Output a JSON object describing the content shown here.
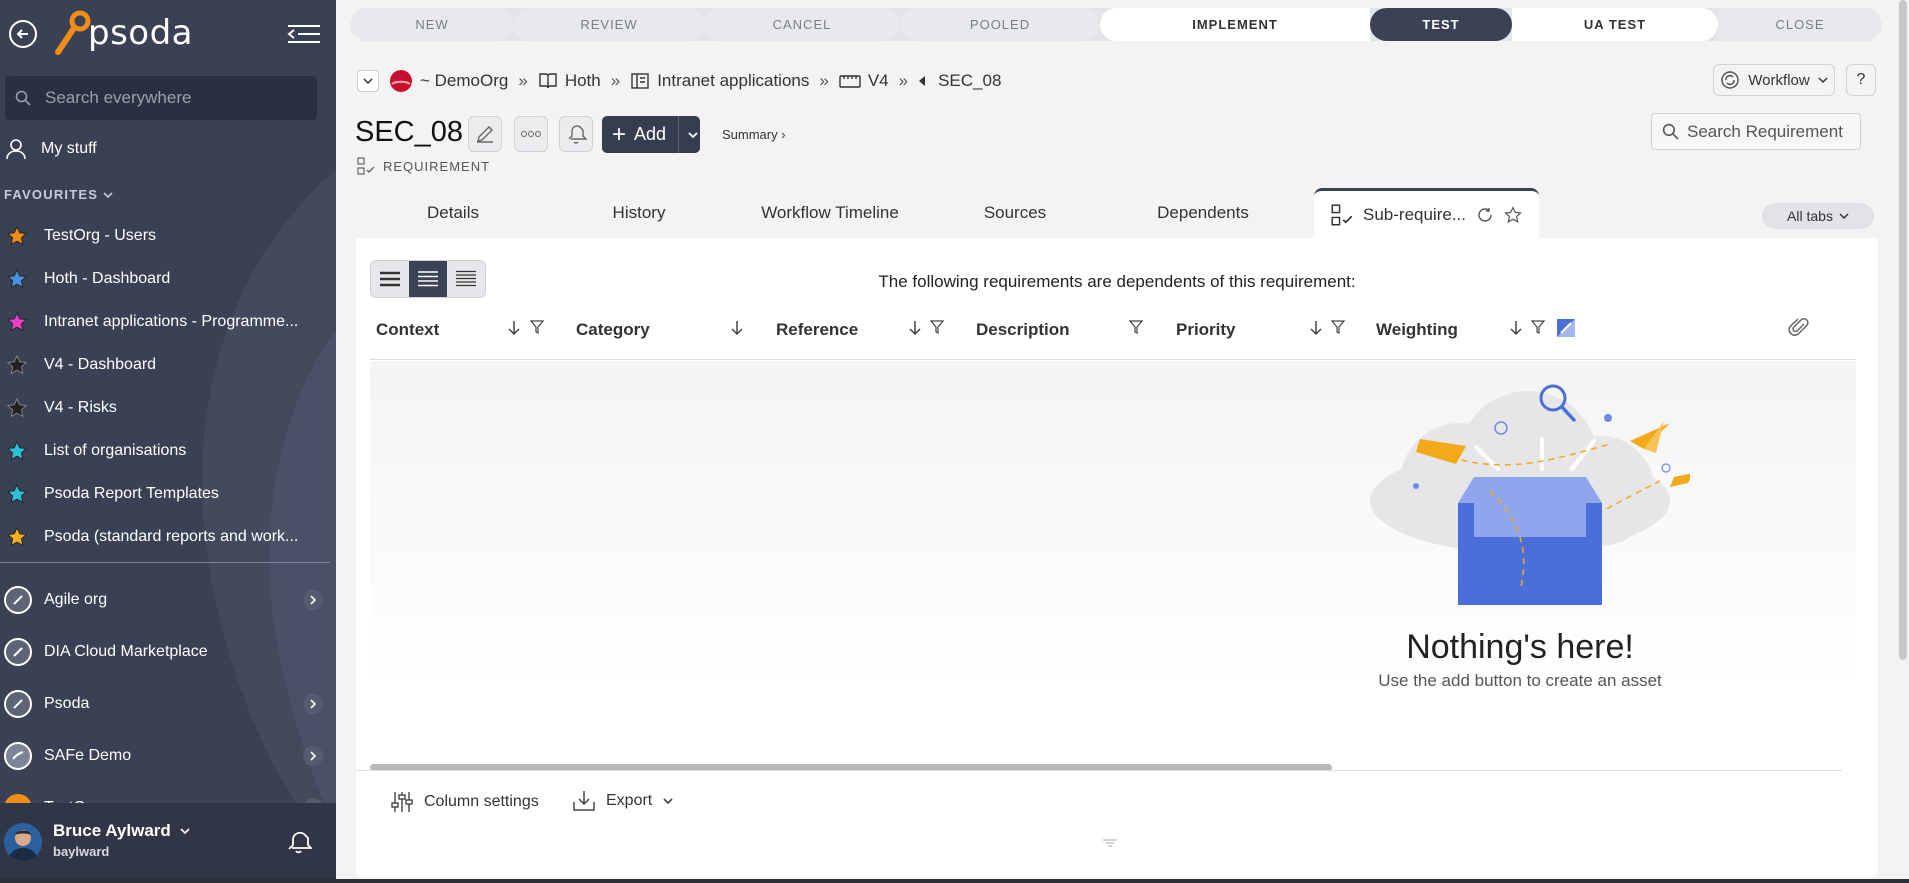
{
  "app": {
    "logo_text": "psoda",
    "accent_orange": "#f28c1a",
    "sidebar_bg": "#3a4154",
    "dark_navy": "#3b4256"
  },
  "sidebar": {
    "search_placeholder": "Search everywhere",
    "my_stuff": "My stuff",
    "favourites_label": "FAVOURITES",
    "favourites": [
      {
        "label": "TestOrg - Users",
        "star_color": "#f28c1a"
      },
      {
        "label": "Hoth - Dashboard",
        "star_color": "#4a90e2"
      },
      {
        "label": "Intranet applications - Programme...",
        "star_color": "#e83ec8"
      },
      {
        "label": "V4 - Dashboard",
        "star_color": "#222222"
      },
      {
        "label": "V4 - Risks",
        "star_color": "#222222"
      },
      {
        "label": "List of organisations",
        "star_color": "#2ec0d8"
      },
      {
        "label": "Psoda Report Templates",
        "star_color": "#2ec0d8"
      },
      {
        "label": "Psoda (standard reports and work...",
        "star_color": "#f2b01a"
      }
    ],
    "orgs": [
      {
        "label": "Agile org",
        "has_children": true
      },
      {
        "label": "DIA Cloud Marketplace",
        "has_children": false
      },
      {
        "label": "Psoda",
        "has_children": true
      },
      {
        "label": "SAFe Demo",
        "has_children": true
      },
      {
        "label": "TestOrg",
        "has_children": true
      }
    ],
    "user": {
      "name": "Bruce Aylward",
      "login": "baylward"
    }
  },
  "stages": [
    {
      "label": "NEW",
      "state": "past"
    },
    {
      "label": "REVIEW",
      "state": "past"
    },
    {
      "label": "CANCEL",
      "state": "past"
    },
    {
      "label": "POOLED",
      "state": "past"
    },
    {
      "label": "IMPLEMENT",
      "state": "open"
    },
    {
      "label": "TEST",
      "state": "current"
    },
    {
      "label": "UA TEST",
      "state": "open"
    },
    {
      "label": "CLOSE",
      "state": "past"
    }
  ],
  "breadcrumb": {
    "org": "~ DemoOrg",
    "items": [
      "Hoth",
      "Intranet applications",
      "V4"
    ],
    "current": "SEC_08"
  },
  "header": {
    "workflow_label": "Workflow",
    "help_label": "?",
    "title": "SEC_08",
    "add_label": "Add",
    "summary_label": "Summary ›",
    "type_label": "REQUIREMENT",
    "search_placeholder": "Search Requirement"
  },
  "tabs": {
    "items": [
      "Details",
      "History",
      "Workflow Timeline",
      "Sources",
      "Dependents"
    ],
    "active": "Sub-require...",
    "all_tabs_label": "All tabs"
  },
  "grid": {
    "message": "The following requirements are dependents of this requirement:",
    "columns": [
      "Context",
      "Category",
      "Reference",
      "Description",
      "Priority",
      "Weighting"
    ],
    "empty_title": "Nothing's here!",
    "empty_subtitle": "Use the add button to create an asset",
    "column_settings_label": "Column settings",
    "export_label": "Export"
  }
}
